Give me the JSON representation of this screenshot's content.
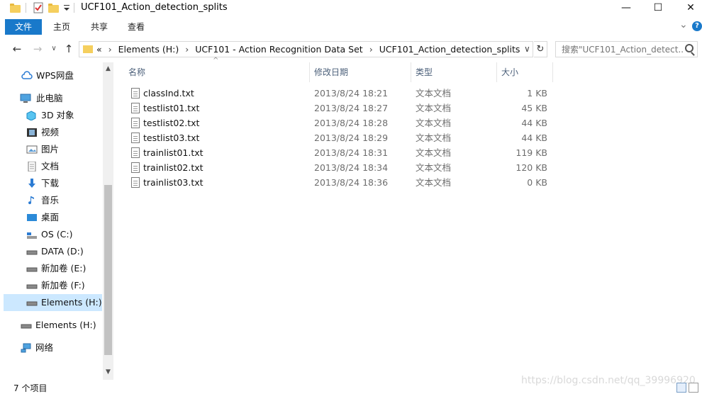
{
  "window": {
    "title": "UCF101_Action_detection_splits",
    "minimize_glyph": "—",
    "maximize_glyph": "☐",
    "close_glyph": "✕"
  },
  "ribbon": {
    "tabs": [
      "文件",
      "主页",
      "共享",
      "查看"
    ],
    "expand_glyph": "⌄",
    "help_glyph": "?"
  },
  "address": {
    "overflow": "«",
    "crumbs": [
      "Elements (H:)",
      "UCF101 - Action Recognition Data Set",
      "UCF101_Action_detection_splits"
    ],
    "separator": "›",
    "dropdown_glyph": "∨",
    "refresh_glyph": "↻"
  },
  "search": {
    "placeholder": "搜索\"UCF101_Action_detect..."
  },
  "nav": {
    "back_glyph": "←",
    "forward_glyph": "→",
    "recent_glyph": "∨",
    "up_glyph": "↑"
  },
  "navpane": {
    "items": [
      {
        "label": "WPS网盘",
        "icon": "cloud-icon"
      },
      {
        "label": "此电脑",
        "icon": "computer-icon"
      },
      {
        "label": "3D 对象",
        "icon": "3d-objects-icon"
      },
      {
        "label": "视频",
        "icon": "video-icon"
      },
      {
        "label": "图片",
        "icon": "pictures-icon"
      },
      {
        "label": "文档",
        "icon": "documents-icon"
      },
      {
        "label": "下载",
        "icon": "download-icon"
      },
      {
        "label": "音乐",
        "icon": "music-icon"
      },
      {
        "label": "桌面",
        "icon": "desktop-icon"
      },
      {
        "label": "OS (C:)",
        "icon": "os-drive-icon"
      },
      {
        "label": "DATA (D:)",
        "icon": "drive-icon"
      },
      {
        "label": "新加卷 (E:)",
        "icon": "drive-icon"
      },
      {
        "label": "新加卷 (F:)",
        "icon": "drive-icon"
      },
      {
        "label": "Elements (H:)",
        "icon": "drive-icon",
        "selected": true
      },
      {
        "label": "Elements (H:)",
        "icon": "drive-icon"
      },
      {
        "label": "网络",
        "icon": "network-icon"
      }
    ]
  },
  "columns": {
    "name": "名称",
    "date": "修改日期",
    "type": "类型",
    "size": "大小",
    "sort_glyph": "^"
  },
  "files": [
    {
      "name": "classInd.txt",
      "date": "2013/8/24 18:21",
      "type": "文本文档",
      "size": "1 KB"
    },
    {
      "name": "testlist01.txt",
      "date": "2013/8/24 18:27",
      "type": "文本文档",
      "size": "45 KB"
    },
    {
      "name": "testlist02.txt",
      "date": "2013/8/24 18:28",
      "type": "文本文档",
      "size": "44 KB"
    },
    {
      "name": "testlist03.txt",
      "date": "2013/8/24 18:29",
      "type": "文本文档",
      "size": "44 KB"
    },
    {
      "name": "trainlist01.txt",
      "date": "2013/8/24 18:31",
      "type": "文本文档",
      "size": "119 KB"
    },
    {
      "name": "trainlist02.txt",
      "date": "2013/8/24 18:34",
      "type": "文本文档",
      "size": "120 KB"
    },
    {
      "name": "trainlist03.txt",
      "date": "2013/8/24 18:36",
      "type": "文本文档",
      "size": "0 KB"
    }
  ],
  "status": {
    "item_count": "7 个项目"
  },
  "watermark": "https://blog.csdn.net/qq_39996920",
  "colors": {
    "accent": "#1979ca",
    "selection": "#cce8ff",
    "folder": "#f5cf5e"
  }
}
